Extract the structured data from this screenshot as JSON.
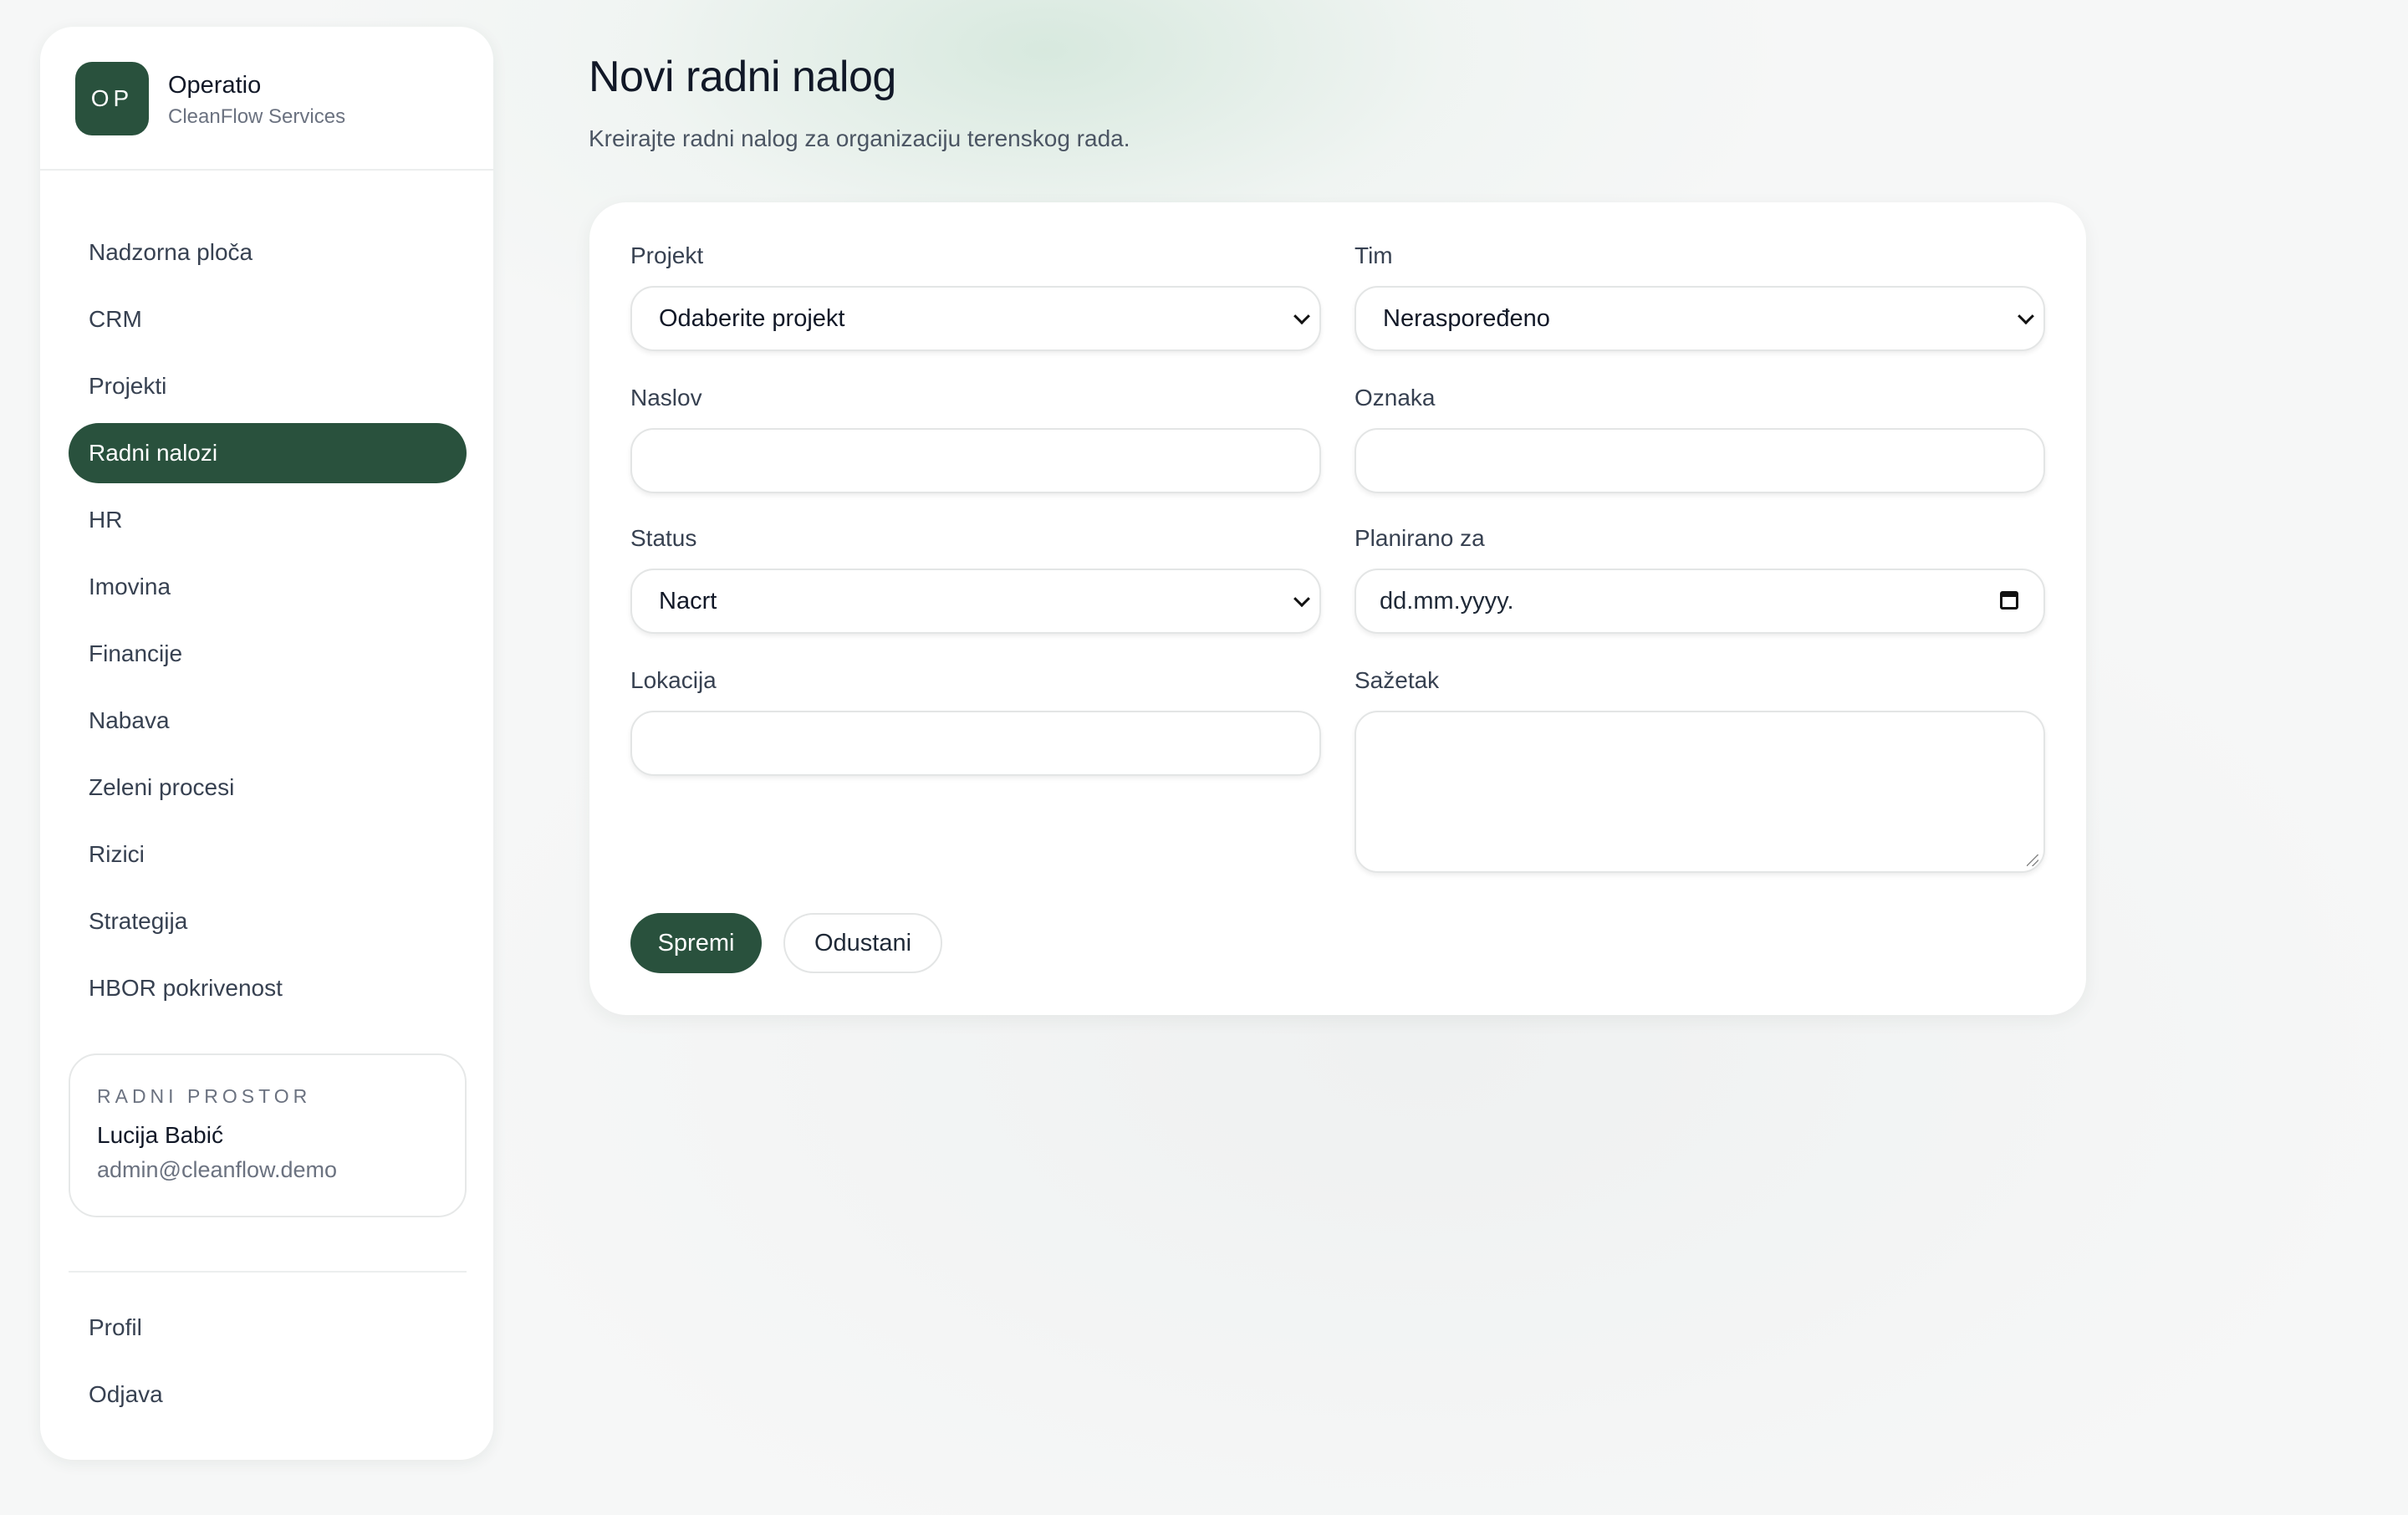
{
  "brand": {
    "initials": "OP",
    "name": "Operatio",
    "subtitle": "CleanFlow Services"
  },
  "nav": {
    "items": [
      {
        "label": "Nadzorna ploča",
        "active": false
      },
      {
        "label": "CRM",
        "active": false
      },
      {
        "label": "Projekti",
        "active": false
      },
      {
        "label": "Radni nalozi",
        "active": true
      },
      {
        "label": "HR",
        "active": false
      },
      {
        "label": "Imovina",
        "active": false
      },
      {
        "label": "Financije",
        "active": false
      },
      {
        "label": "Nabava",
        "active": false
      },
      {
        "label": "Zeleni procesi",
        "active": false
      },
      {
        "label": "Rizici",
        "active": false
      },
      {
        "label": "Strategija",
        "active": false
      },
      {
        "label": "HBOR pokrivenost",
        "active": false
      }
    ]
  },
  "workspace": {
    "caption": "RADNI PROSTOR",
    "user": "Lucija Babić",
    "email": "admin@cleanflow.demo"
  },
  "bottom_nav": {
    "profile": "Profil",
    "logout": "Odjava"
  },
  "page": {
    "title": "Novi radni nalog",
    "subtitle": "Kreirajte radni nalog za organizaciju terenskog rada."
  },
  "form": {
    "project": {
      "label": "Projekt",
      "value": "Odaberite projekt"
    },
    "team": {
      "label": "Tim",
      "value": "Neraspoređeno"
    },
    "title": {
      "label": "Naslov",
      "value": ""
    },
    "tag": {
      "label": "Oznaka",
      "value": ""
    },
    "status": {
      "label": "Status",
      "value": "Nacrt"
    },
    "planned": {
      "label": "Planirano za",
      "placeholder": "dd.mm.yyyy."
    },
    "location": {
      "label": "Lokacija",
      "value": ""
    },
    "summary": {
      "label": "Sažetak",
      "value": ""
    },
    "save_label": "Spremi",
    "cancel_label": "Odustani"
  },
  "colors": {
    "accent": "#29513d",
    "background": "#f6f7f7"
  }
}
